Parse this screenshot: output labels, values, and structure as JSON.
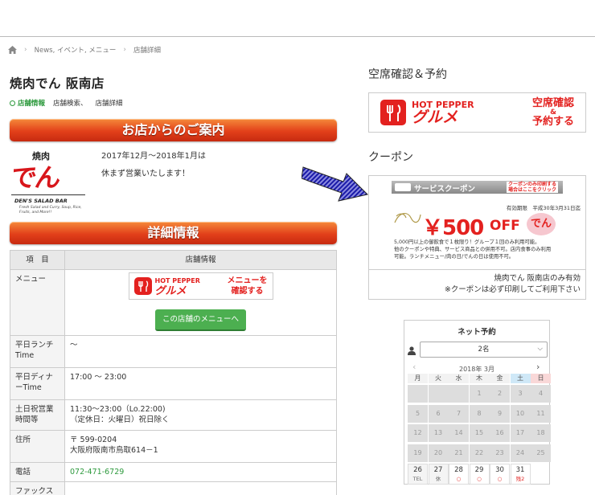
{
  "breadcrumb": {
    "items": [
      "News, イベント, メニュー",
      "店舗詳細"
    ]
  },
  "page": {
    "title": "焼肉でん 阪南店"
  },
  "subnav": {
    "items": [
      "店舗情報",
      "店舗検索、",
      "店舗詳細"
    ]
  },
  "banners": {
    "intro": "お店からのご案内",
    "details": "詳細情報"
  },
  "logo": {
    "main": "焼肉",
    "sub": "でん",
    "tag": "DEN'S SALAD BAR",
    "small": "Fresh Salad and Curry, Soup, Rice, Fruits, and More!!"
  },
  "notice": {
    "line1": "2017年12月〜2018年1月は",
    "line2": "休まず営業いたします！"
  },
  "table": {
    "head_key": "項　目",
    "head_val": "店舗情報",
    "menu_key": "メニュー",
    "menu_button": "この店舗のメニューへ",
    "lunch_key": "平日ランチTime",
    "lunch_val": "〜",
    "dinner_key": "平日ディナーTime",
    "dinner_val": "17:00 〜 23:00",
    "weekend_key": "土日祝営業時間等",
    "weekend_val1": "11:30〜23:00（Lo.22:00)",
    "weekend_val2": "（定休日：火曜日）祝日除く",
    "addr_key": "住所",
    "addr_val1": "〒 599-0204",
    "addr_val2": "大阪府阪南市鳥取614－1",
    "tel_key": "電話",
    "tel_val": "072-471-6729",
    "fax_key": "ファックス"
  },
  "hotpepper": {
    "brand": "HOT PEPPER",
    "brand_jp": "グルメ",
    "cta_right": [
      "空席確認",
      "&",
      "予約する"
    ],
    "cta_small": [
      "メニューを",
      "確認する"
    ]
  },
  "right": {
    "reserve_title": "空席確認＆予約",
    "coupon_title": "クーポン"
  },
  "coupon": {
    "service": "サービスクーポン",
    "print_note": [
      "クーポンのみ印刷する",
      "場合はここをクリック"
    ],
    "expiry": "有効期限　平成30年3月31日迄",
    "amount": "￥500",
    "off": "OFF",
    "desc": [
      "5,000円以上の御飲食で１枚限り！グループ１回のみ利用可能。",
      "他のクーポンや特典、サービス商品との併用不可。店内食事のみ利用",
      "可能。ランチメニュー/肉の日/でんの日は使用不可。"
    ],
    "shop": "焼肉でん 阪南店のみ有効",
    "note": "※クーポンは必ず印刷してご利用下さい"
  },
  "calendar": {
    "title": "ネット予約",
    "people": "2名",
    "month": "2018年 3月",
    "weekdays": [
      "月",
      "火",
      "水",
      "木",
      "金",
      "土",
      "日"
    ],
    "weeks": [
      [
        "",
        "",
        "",
        "1",
        "2",
        "3",
        "4"
      ],
      [
        "5",
        "6",
        "7",
        "8",
        "9",
        "10",
        "11"
      ],
      [
        "12",
        "13",
        "14",
        "15",
        "16",
        "17",
        "18"
      ],
      [
        "19",
        "20",
        "21",
        "22",
        "23",
        "24",
        "25"
      ]
    ],
    "last": [
      {
        "d": "26",
        "s": "TEL"
      },
      {
        "d": "27",
        "s": "休"
      },
      {
        "d": "28",
        "s": "○"
      },
      {
        "d": "29",
        "s": "○"
      },
      {
        "d": "30",
        "s": "○"
      },
      {
        "d": "31",
        "s": "残2"
      }
    ]
  },
  "colors": {
    "accent": "#e3211f",
    "green": "#2e9a3e",
    "sat": "#cfe8f7",
    "sun": "#f9d8d8"
  }
}
